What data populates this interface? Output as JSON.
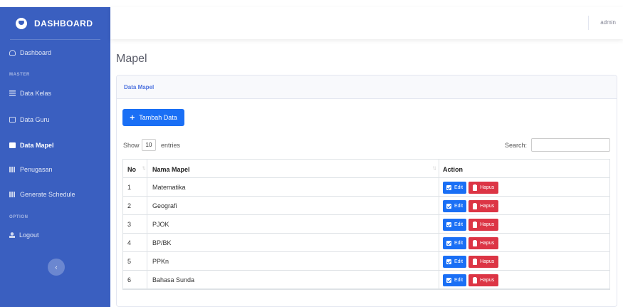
{
  "brand": {
    "title": "DASHBOARD",
    "icon": "laugh-icon"
  },
  "sidebar": {
    "dashboard": "Dashboard",
    "section_master": "MASTER",
    "section_option": "OPTION",
    "items": [
      {
        "label": "Data Kelas",
        "icon": "table-icon"
      },
      {
        "label": "Data Guru",
        "icon": "box-icon"
      },
      {
        "label": "Data Mapel",
        "icon": "book-icon"
      },
      {
        "label": "Penugasan",
        "icon": "grid-icon"
      },
      {
        "label": "Generate Schedule",
        "icon": "grid-icon"
      }
    ],
    "logout": "Logout",
    "toggle_glyph": "‹"
  },
  "topbar": {
    "user": "admin"
  },
  "page": {
    "title": "Mapel"
  },
  "card": {
    "header": "Data Mapel",
    "add_button": "Tambah Data",
    "show_label": "Show",
    "length_value": "10",
    "entries_label": "entries",
    "search_label": "Search:"
  },
  "table": {
    "headers": {
      "no": "No",
      "name": "Nama Mapel",
      "action": "Action"
    },
    "edit_label": "Edit",
    "delete_label": "Hapus",
    "rows": [
      {
        "no": "1",
        "name": "Matematika"
      },
      {
        "no": "2",
        "name": "Geografi"
      },
      {
        "no": "3",
        "name": "PJOK"
      },
      {
        "no": "4",
        "name": "BP/BK"
      },
      {
        "no": "5",
        "name": "PPKn"
      },
      {
        "no": "6",
        "name": "Bahasa Sunda"
      }
    ]
  },
  "colors": {
    "sidebar": "#3a5fc0",
    "primary": "#1a6ff5",
    "danger": "#dc3545"
  }
}
